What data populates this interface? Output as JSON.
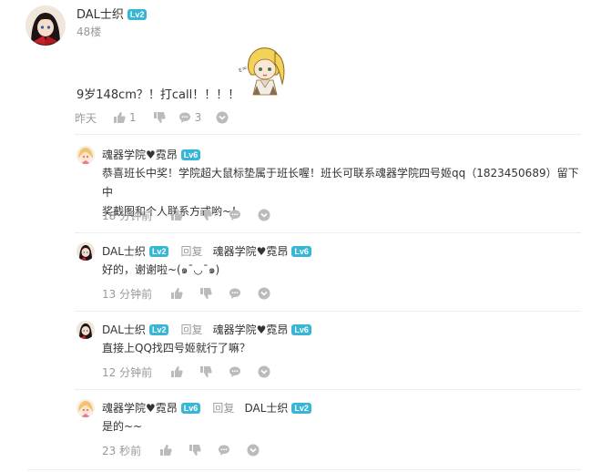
{
  "main_post": {
    "username": "DAL士织",
    "level": "Lv2",
    "floor": "48楼",
    "content": "9岁148cm？！打call！！！！",
    "time": "昨天",
    "likes": "1",
    "comments": "3"
  },
  "replies": [
    {
      "username": "魂器学院♥霓昂",
      "level": "Lv6",
      "content_line1": "恭喜班长中奖！学院超大鼠标垫属于班长喔！班长可联系魂器学院四号姬qq（1823450689）留下中",
      "content_line2": "奖截图和个人联系方式哟~！",
      "time": "18 分钟前"
    },
    {
      "username": "DAL士织",
      "level": "Lv2",
      "reply_word": "回复",
      "reply_to": "魂器学院♥霓昂",
      "reply_to_level": "Lv6",
      "content": "好的，谢谢啦~(๑¯◡¯๑)",
      "time": "13 分钟前"
    },
    {
      "username": "DAL士织",
      "level": "Lv2",
      "reply_word": "回复",
      "reply_to": "魂器学院♥霓昂",
      "reply_to_level": "Lv6",
      "content": "直接上QQ找四号姬就行了嘛？",
      "time": "12 分钟前"
    },
    {
      "username": "魂器学院♥霓昂",
      "level": "Lv6",
      "reply_word": "回复",
      "reply_to": "DAL士织",
      "reply_to_level": "Lv2",
      "content": "是的~~",
      "time": "23 秒前"
    }
  ],
  "colors": {
    "level_badge": "#39b6d6",
    "meta_gray": "#999999",
    "text": "#333333"
  }
}
